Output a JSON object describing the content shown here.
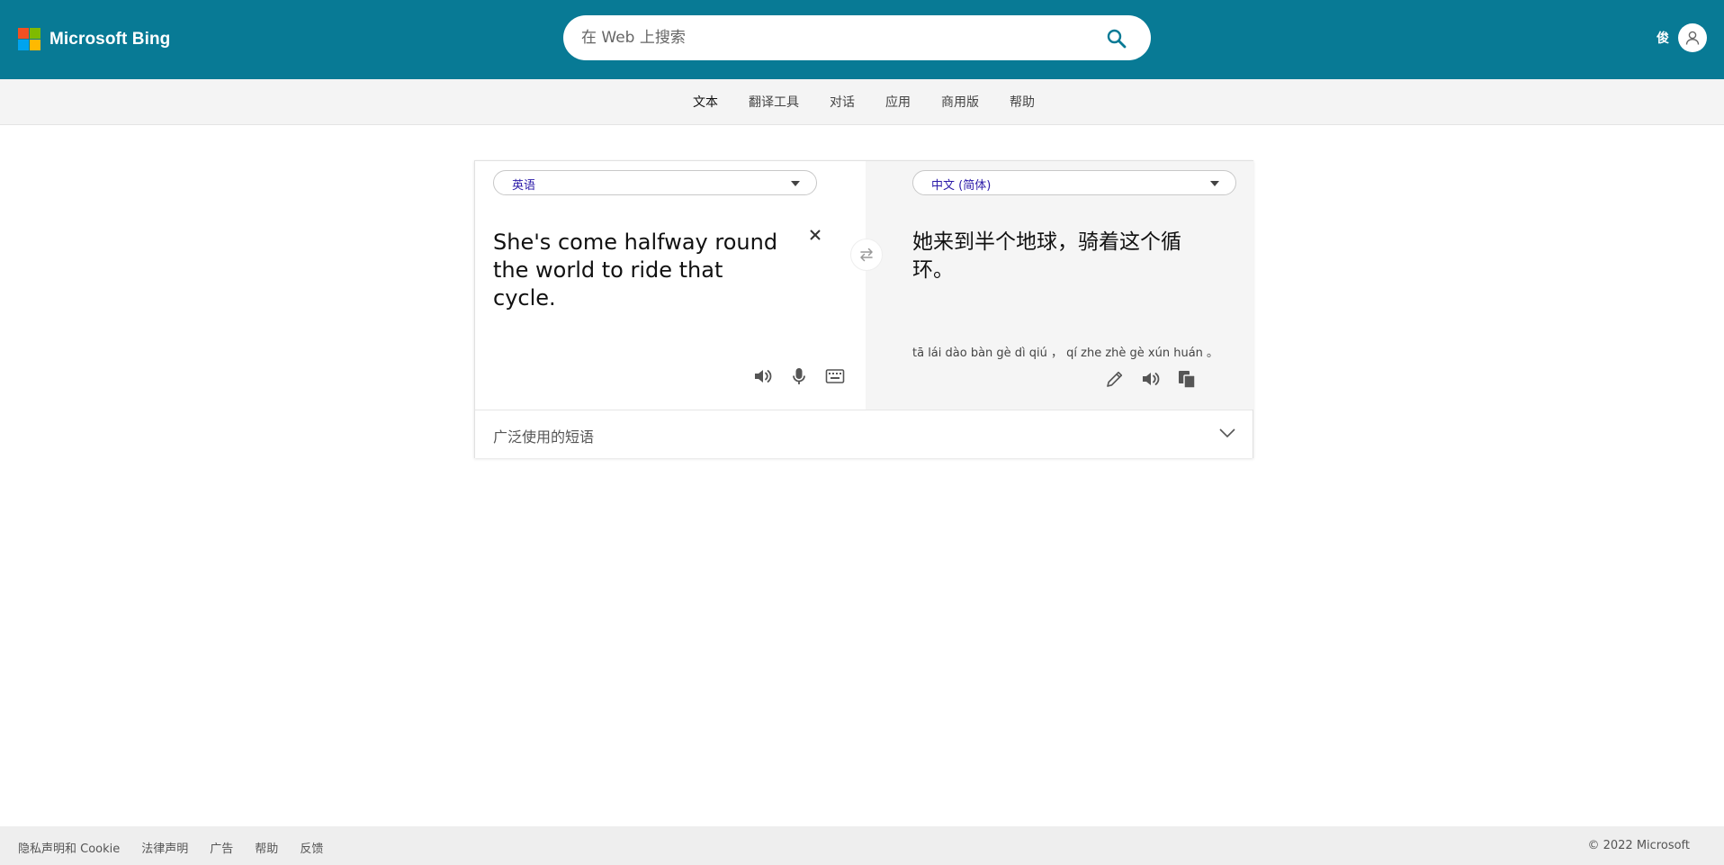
{
  "header": {
    "brand": "Microsoft Bing",
    "logo_colors": [
      "#f25022",
      "#7fba00",
      "#00a4ef",
      "#ffb900"
    ],
    "search_placeholder": "在 Web 上搜索",
    "search_icon": "search-icon",
    "user_name": "俊",
    "avatar_icon": "user-icon"
  },
  "nav": {
    "items": [
      {
        "label": "文本",
        "active": true
      },
      {
        "label": "翻译工具"
      },
      {
        "label": "对话"
      },
      {
        "label": "应用"
      },
      {
        "label": "商用版"
      },
      {
        "label": "帮助"
      }
    ]
  },
  "translator": {
    "source_language": "英语",
    "target_language": "中文 (简体)",
    "source_text": "She's come halfway round the world to ride that cycle.",
    "target_text": "她来到半个地球，骑着这个循环。",
    "pinyin": "tā lái dào bàn gè dì qiú ，  qí zhe zhè gè xún huán 。",
    "source_tools": [
      "speaker-icon",
      "microphone-icon",
      "keyboard-icon"
    ],
    "target_tools": [
      "pencil-icon",
      "speaker-icon",
      "copy-icon"
    ],
    "swap_icon": "swap-arrows-icon",
    "phrases_label": "广泛使用的短语"
  },
  "footer": {
    "links": [
      "隐私声明和 Cookie",
      "法律声明",
      "广告",
      "帮助",
      "反馈"
    ],
    "copyright": "© 2022 Microsoft"
  },
  "colors": {
    "header_bg": "#087a95",
    "nav_bg": "#f4f4f4",
    "footer_bg": "#eeeeee",
    "lang_text": "#2b1aa8"
  }
}
